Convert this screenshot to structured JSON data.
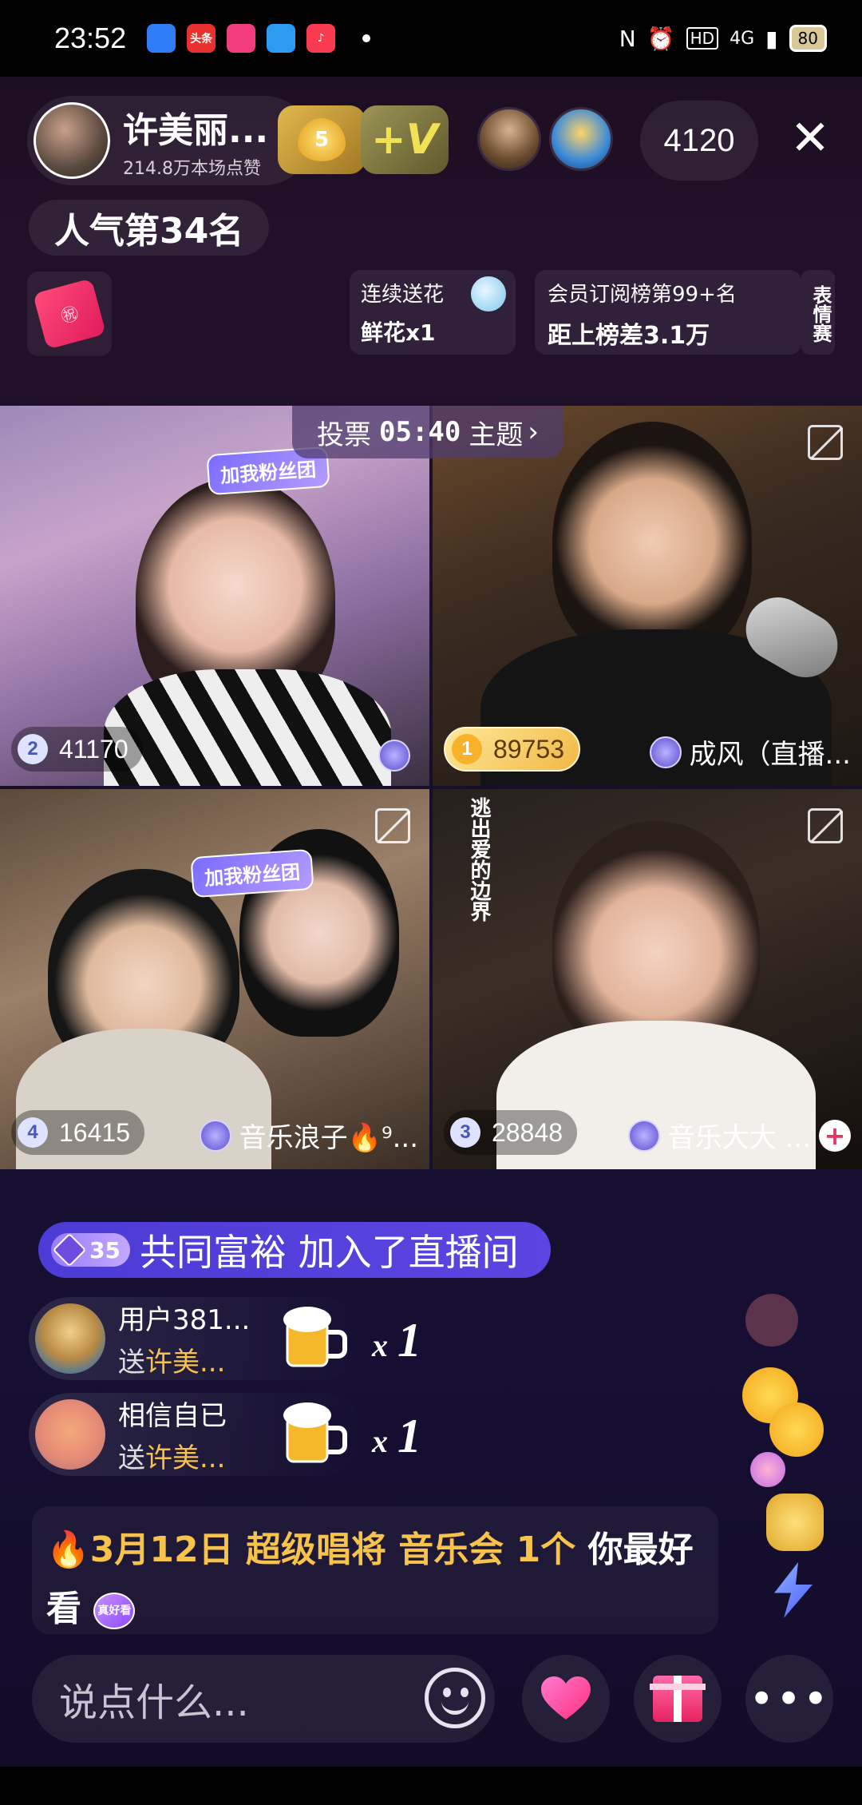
{
  "status": {
    "time": "23:52",
    "apps": [
      {
        "name": "files-app-icon",
        "color": "#2f7cf6",
        "label": ""
      },
      {
        "name": "toutiao-app-icon",
        "color": "#e8312c",
        "label": "头条"
      },
      {
        "name": "pink-app-icon",
        "color": "#f23c7e",
        "label": ""
      },
      {
        "name": "browser-app-icon",
        "color": "#2d9cf0",
        "label": ""
      },
      {
        "name": "music-app-icon",
        "color": "#fa3a4f",
        "label": "♪"
      }
    ],
    "network": "4G",
    "battery": "80"
  },
  "header": {
    "anchor_name": "许美丽...",
    "anchor_likes": "214.8万本场点赞",
    "fan_level": "5",
    "viewer_count": "4120",
    "popularity_rank": "人气第34名"
  },
  "cards": {
    "flower_title": "连续送花",
    "flower_count": "鲜花x1",
    "member_title": "会员订阅榜第99+名",
    "member_diff": "距上榜差3.1万",
    "emoji_contest": "表情赛"
  },
  "vote": {
    "label": "投票",
    "time": "05:40",
    "topic": "主题"
  },
  "fan_tag": "加我粉丝团",
  "tiles": [
    {
      "rank": "2",
      "score": "41170",
      "name": ""
    },
    {
      "rank": "1",
      "score": "89753",
      "name": "成风（直播..."
    },
    {
      "rank": "4",
      "score": "16415",
      "name": "音乐浪子🔥⁹..."
    },
    {
      "rank": "3",
      "score": "28848",
      "name": "音乐大大 ..."
    }
  ],
  "lyric": "逃出爱的边界",
  "chat": {
    "join_level": "35",
    "join_text": "共同富裕 加入了直播间",
    "gifts": [
      {
        "user": "用户381...",
        "send_prefix": "送",
        "target": "许美...",
        "count": "1",
        "times": "x"
      },
      {
        "user": "相信自已",
        "send_prefix": "送",
        "target": "许美...",
        "count": "1",
        "times": "x"
      }
    ],
    "notice_fire": "🔥",
    "notice_date": "3月12日",
    "notice_main": "超级唱将 音乐会",
    "notice_count": "1个",
    "notice_end": "你最好看",
    "nice_badge": "真好看"
  },
  "bottom": {
    "input_placeholder": "说点什么...",
    "more": "•••"
  }
}
